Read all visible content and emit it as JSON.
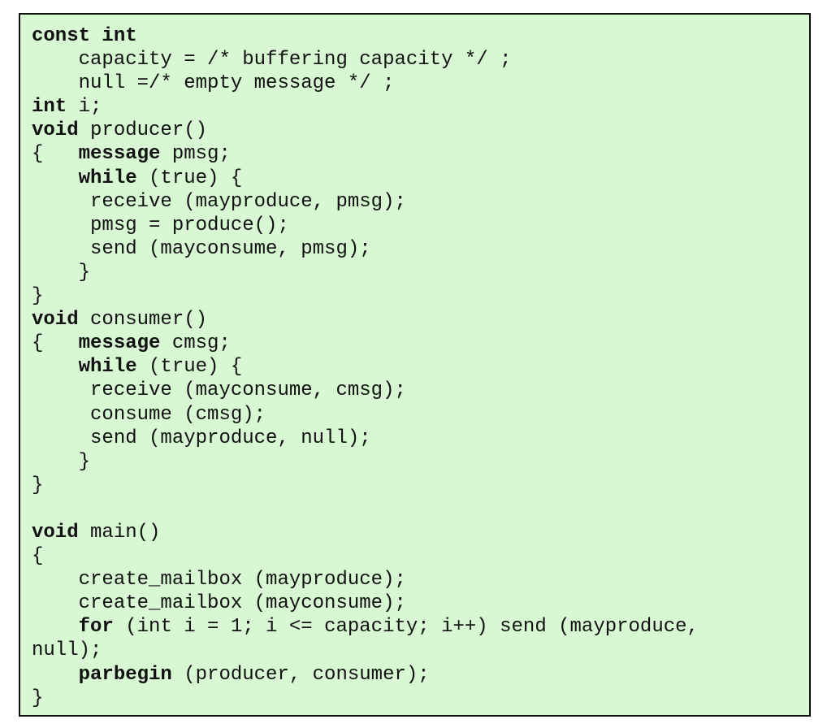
{
  "code": {
    "lines": [
      [
        {
          "t": "const int",
          "b": true
        }
      ],
      [
        {
          "t": "    capacity = /* buffering capacity */ ;",
          "b": false
        }
      ],
      [
        {
          "t": "    null =/* empty message */ ;",
          "b": false
        }
      ],
      [
        {
          "t": "int",
          "b": true
        },
        {
          "t": " i;",
          "b": false
        }
      ],
      [
        {
          "t": "void",
          "b": true
        },
        {
          "t": " producer()",
          "b": false
        }
      ],
      [
        {
          "t": "{   ",
          "b": false
        },
        {
          "t": "message",
          "b": true
        },
        {
          "t": " pmsg;",
          "b": false
        }
      ],
      [
        {
          "t": "    ",
          "b": false
        },
        {
          "t": "while",
          "b": true
        },
        {
          "t": " (true) {",
          "b": false
        }
      ],
      [
        {
          "t": "     receive (mayproduce, pmsg);",
          "b": false
        }
      ],
      [
        {
          "t": "     pmsg = produce();",
          "b": false
        }
      ],
      [
        {
          "t": "     send (mayconsume, pmsg);",
          "b": false
        }
      ],
      [
        {
          "t": "    }",
          "b": false
        }
      ],
      [
        {
          "t": "}",
          "b": false
        }
      ],
      [
        {
          "t": "void",
          "b": true
        },
        {
          "t": " consumer()",
          "b": false
        }
      ],
      [
        {
          "t": "{   ",
          "b": false
        },
        {
          "t": "message",
          "b": true
        },
        {
          "t": " cmsg;",
          "b": false
        }
      ],
      [
        {
          "t": "    ",
          "b": false
        },
        {
          "t": "while",
          "b": true
        },
        {
          "t": " (true) {",
          "b": false
        }
      ],
      [
        {
          "t": "     receive (mayconsume, cmsg);",
          "b": false
        }
      ],
      [
        {
          "t": "     consume (cmsg);",
          "b": false
        }
      ],
      [
        {
          "t": "     send (mayproduce, null);",
          "b": false
        }
      ],
      [
        {
          "t": "    }",
          "b": false
        }
      ],
      [
        {
          "t": "}",
          "b": false
        }
      ],
      [
        {
          "t": "",
          "b": false
        }
      ],
      [
        {
          "t": "void",
          "b": true
        },
        {
          "t": " main()",
          "b": false
        }
      ],
      [
        {
          "t": "{",
          "b": false
        }
      ],
      [
        {
          "t": "    create_mailbox (mayproduce);",
          "b": false
        }
      ],
      [
        {
          "t": "    create_mailbox (mayconsume);",
          "b": false
        }
      ],
      [
        {
          "t": "    ",
          "b": false
        },
        {
          "t": "for",
          "b": true
        },
        {
          "t": " (int i = 1; i <= capacity; i++) send (mayproduce,",
          "b": false
        }
      ],
      [
        {
          "t": "null);",
          "b": false
        }
      ],
      [
        {
          "t": "    ",
          "b": false
        },
        {
          "t": "parbegin",
          "b": true
        },
        {
          "t": " (producer, consumer);",
          "b": false
        }
      ],
      [
        {
          "t": "}",
          "b": false
        }
      ]
    ]
  },
  "colors": {
    "background": "#d8f8d4",
    "border": "#111111",
    "text": "#111111"
  }
}
